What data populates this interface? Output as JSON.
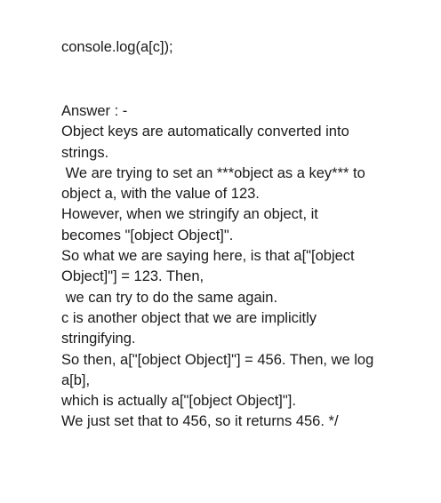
{
  "document": {
    "code_line": "console.log(a[c]);",
    "answer_lines": [
      "Answer : -",
      "Object keys are automatically converted into",
      "strings.",
      " We are trying to set an ***object as a key*** to",
      "object a, with the value of 123.",
      "However, when we stringify an object, it",
      "becomes \"[object Object]\".",
      "So what we are saying here, is that a[\"[object",
      "Object]\"] = 123. Then,",
      " we can try to do the same again.",
      "c is another object that we are implicitly",
      "stringifying.",
      "So then, a[\"[object Object]\"] = 456. Then, we log",
      "a[b],",
      "which is actually a[\"[object Object]\"].",
      "We just set that to 456, so it returns 456. */"
    ]
  }
}
